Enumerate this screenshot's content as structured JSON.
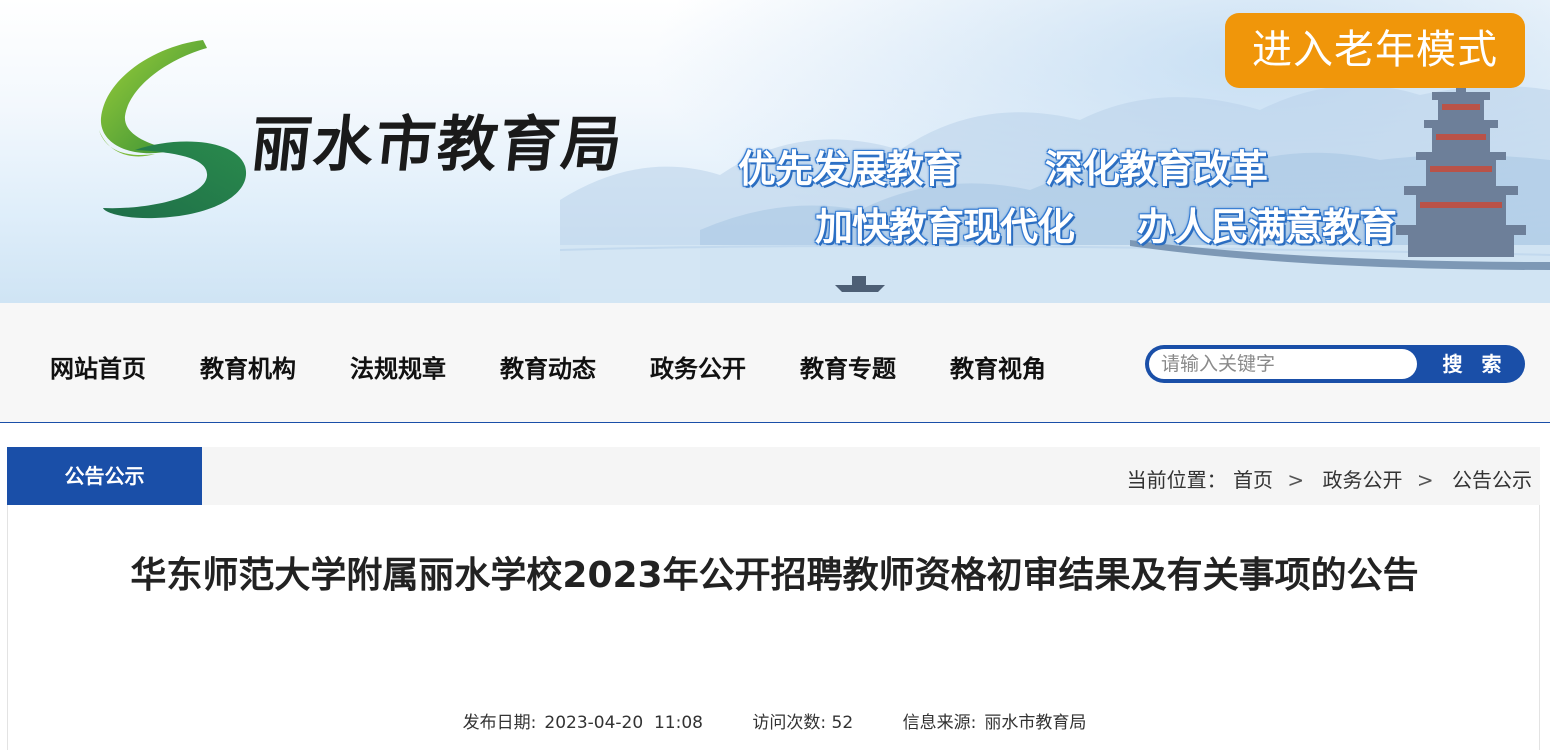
{
  "header": {
    "site_title": "丽水市教育局",
    "elder_mode_button": "进入老年模式",
    "slogans": [
      "优先发展教育",
      "深化教育改革",
      "加快教育现代化",
      "办人民满意教育"
    ]
  },
  "nav": {
    "items": [
      "网站首页",
      "教育机构",
      "法规规章",
      "教育动态",
      "政务公开",
      "教育专题",
      "教育视角"
    ],
    "search_placeholder": "请输入关键字",
    "search_button": "搜 索"
  },
  "section": {
    "tab_label": "公告公示",
    "breadcrumb_prefix": "当前位置：",
    "breadcrumb": [
      "首页",
      "政务公开",
      "公告公示"
    ],
    "separator": ">"
  },
  "article": {
    "title": "华东师范大学附属丽水学校2023年公开招聘教师资格初审结果及有关事项的公告",
    "publish_label": "发布日期:",
    "publish_value": "2023-04-20  11:08",
    "views_label": "访问次数:",
    "views_value": "52",
    "source_label": "信息来源:",
    "source_value": "丽水市教育局"
  },
  "colors": {
    "primary_blue": "#1a4fa8",
    "elder_button_orange": "#f0960a",
    "logo_green": "#3e9b3c"
  }
}
